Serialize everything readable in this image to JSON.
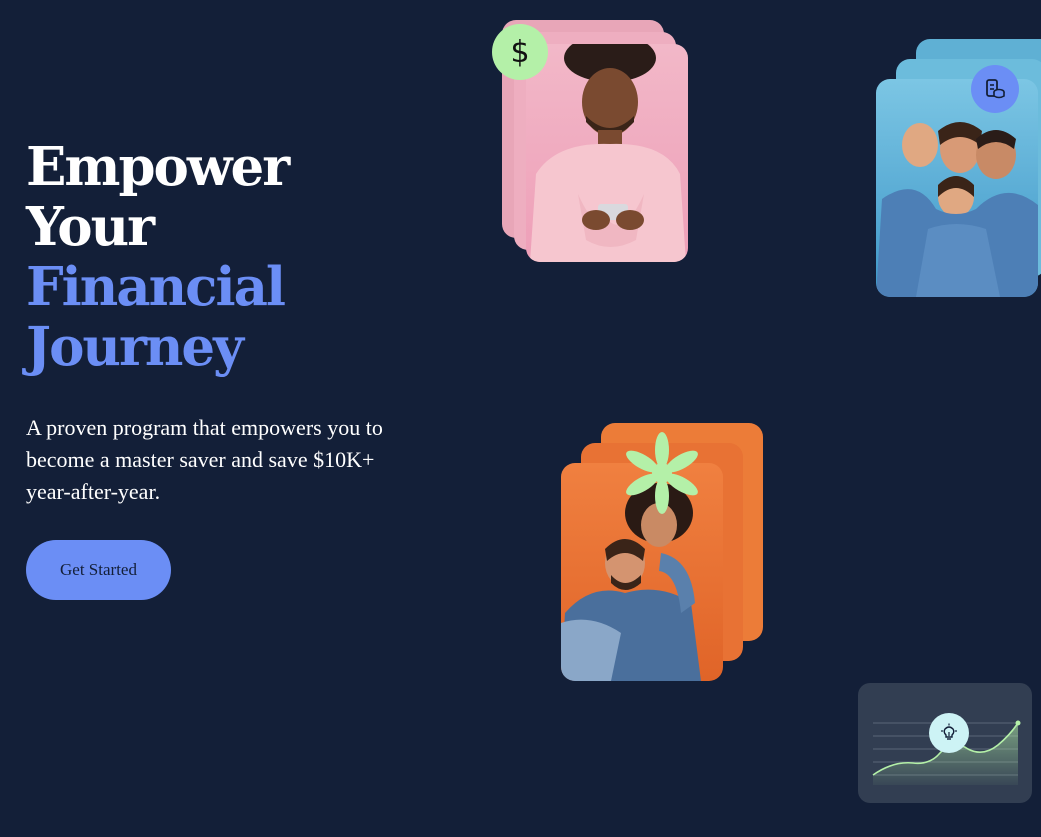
{
  "hero": {
    "title_line1": "Empower",
    "title_line2": "Your",
    "title_line3": "Financial",
    "title_line4": "Journey",
    "description": "A proven program that empowers you to become a master saver and save $10K+ year-after-year.",
    "cta_label": "Get Started"
  },
  "badges": {
    "dollar_symbol": "$",
    "dollar_icon": "dollar-icon",
    "coins_icon": "coins-stack-icon",
    "bulb_icon": "lightbulb-icon",
    "asterisk_icon": "asterisk-icon"
  },
  "images": {
    "pink_card": "man-smiling-at-phone-photo",
    "blue_card": "family-laughing-photo",
    "orange_card": "couple-piggyback-photo"
  },
  "colors": {
    "background": "#131f38",
    "accent_blue": "#6b8ef5",
    "accent_green": "#b4f0a8",
    "text_white": "#ffffff"
  }
}
